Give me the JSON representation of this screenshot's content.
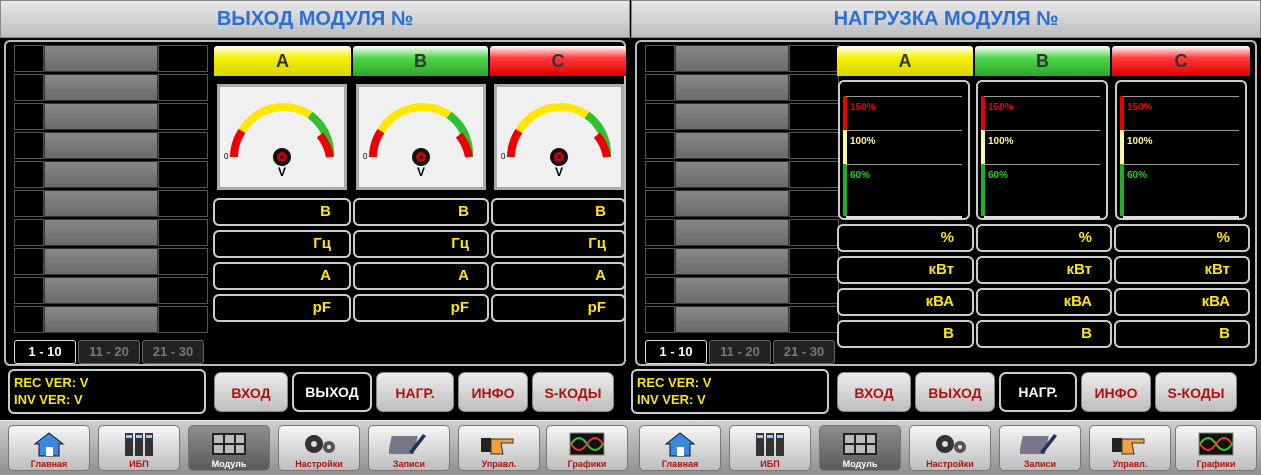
{
  "left": {
    "title": "ВЫХОД МОДУЛЯ №",
    "pager": [
      "1 - 10",
      "11 - 20",
      "21 - 30"
    ],
    "phases": [
      "A",
      "B",
      "C"
    ],
    "gauge_unit": "V",
    "gauge_zero": "0",
    "units": [
      "В",
      "Гц",
      "А",
      "pF"
    ],
    "ver_lines": [
      "REC VER: V",
      "INV VER: V"
    ],
    "tabs": [
      "ВХОД",
      "ВЫХОД",
      "НАГР.",
      "ИНФО",
      "S-КОДЫ"
    ],
    "active_tab": "ВЫХОД"
  },
  "right": {
    "title": "НАГРУЗКА МОДУЛЯ №",
    "pager": [
      "1 - 10",
      "11 - 20",
      "21 - 30"
    ],
    "phases": [
      "A",
      "B",
      "C"
    ],
    "levels": [
      "150%",
      "100%",
      "60%"
    ],
    "units": [
      "%",
      "кВт",
      "кВА",
      "В"
    ],
    "ver_lines": [
      "REC VER: V",
      "INV VER: V"
    ],
    "tabs": [
      "ВХОД",
      "ВЫХОД",
      "НАГР.",
      "ИНФО",
      "S-КОДЫ"
    ],
    "active_tab": "НАГР."
  },
  "toolbar": [
    "Главная",
    "ИБП",
    "Модуль",
    "Настройки",
    "Записи",
    "Управл.",
    "Графики"
  ],
  "toolbar_selected": "Модуль",
  "colors": {
    "title_text": "#2a6fd6",
    "value_text": "#ffe600",
    "tab_text": "#b01010"
  }
}
